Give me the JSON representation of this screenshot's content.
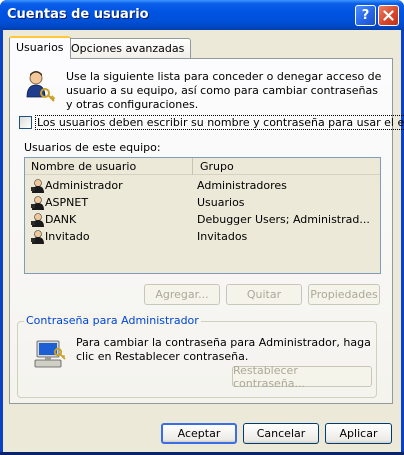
{
  "window": {
    "title": "Cuentas de usuario",
    "help_button": "?",
    "close_icon": "close-icon"
  },
  "tabs": [
    {
      "label": "Usuarios",
      "active": true
    },
    {
      "label": "Opciones avanzadas",
      "active": false
    }
  ],
  "intro": {
    "icon": "users-keys-icon",
    "text": "Use la siguiente lista para conceder o denegar acceso de usuario a su equipo, así como para cambiar contraseñas y otras configuraciones."
  },
  "require_login": {
    "checked": false,
    "label": "Los usuarios deben escribir su nombre y contraseña para usar el equipo."
  },
  "users": {
    "label": "Usuarios de este equipo:",
    "columns": [
      "Nombre de usuario",
      "Grupo"
    ],
    "rows": [
      {
        "name": "Administrador",
        "group": "Administradores"
      },
      {
        "name": "ASPNET",
        "group": "Usuarios"
      },
      {
        "name": "DANK",
        "group": "Debugger Users; Administrad..."
      },
      {
        "name": "Invitado",
        "group": "Invitados"
      }
    ]
  },
  "list_buttons": {
    "add": "Agregar...",
    "remove": "Quitar",
    "properties": "Propiedades"
  },
  "admin_password": {
    "title": "Contraseña para Administrador",
    "icon": "computer-key-icon",
    "text": "Para cambiar la contraseña para Administrador, haga clic en Restablecer contraseña.",
    "reset_button": "Restablecer contraseña..."
  },
  "dialog_buttons": {
    "ok": "Aceptar",
    "cancel": "Cancelar",
    "apply": "Aplicar"
  },
  "colors": {
    "titlebar": "#0054e3",
    "dialog_bg": "#ece9d8",
    "groupbox_title": "#0046d5",
    "tab_highlight": "#ffc83c"
  }
}
